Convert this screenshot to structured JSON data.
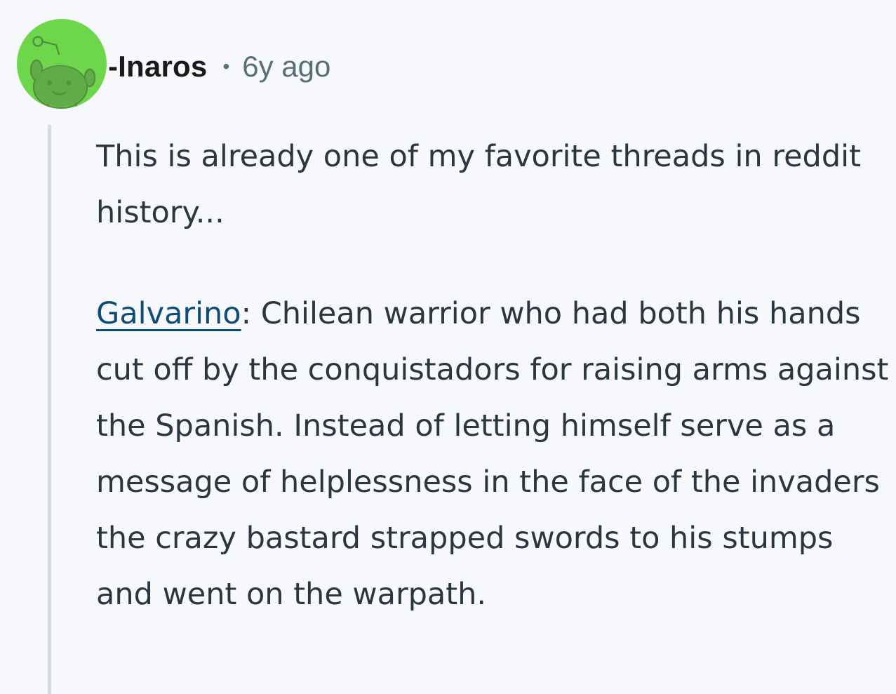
{
  "comment": {
    "author": "-Inaros",
    "separator": "•",
    "timestamp": "6y ago",
    "avatar_icon": "snoo-avatar-icon",
    "accent_color": "#6ed64b",
    "paragraph_1": "This is already one of my favorite threads in reddit history...",
    "paragraph_2": {
      "link_text": "Galvarino",
      "text": ": Chilean warrior who had both his hands cut off by the conquistadors for raising arms against the Spanish. Instead of letting himself serve as a message of helplessness in the face of the invaders the crazy bastard strapped swords to his stumps and went on the warpath."
    }
  }
}
